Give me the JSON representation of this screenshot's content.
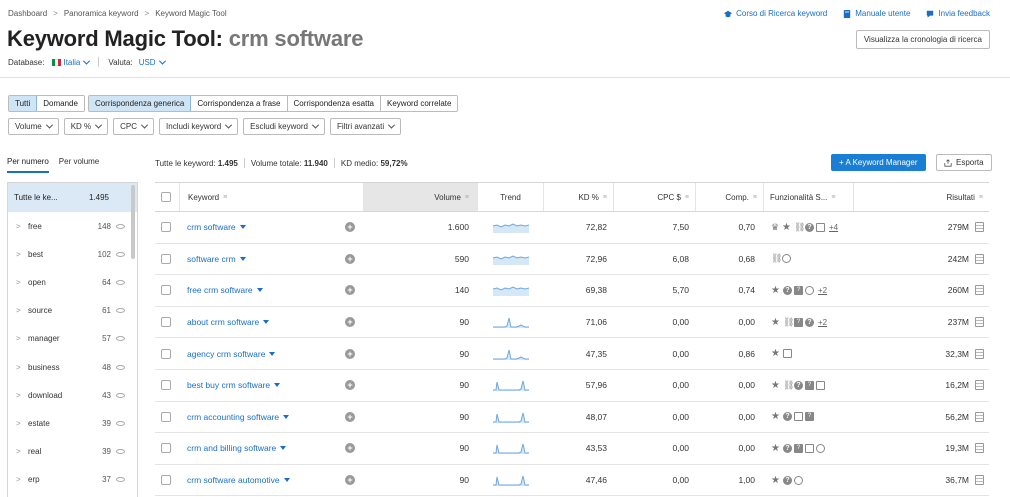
{
  "breadcrumb": [
    "Dashboard",
    "Panoramica keyword",
    "Keyword Magic Tool"
  ],
  "toplinks": {
    "course": "Corso di Ricerca keyword",
    "manual": "Manuale utente",
    "feedback": "Invia feedback"
  },
  "title": {
    "tool": "Keyword Magic Tool:",
    "keyword": "crm software"
  },
  "history_button": "Visualizza la cronologia di ricerca",
  "database": {
    "label": "Database:",
    "value": "Italia"
  },
  "currency": {
    "label": "Valuta:",
    "value": "USD"
  },
  "match_tabs_a": [
    "Tutti",
    "Domande"
  ],
  "match_tabs_b": [
    "Corrispondenza generica",
    "Corrispondenza a frase",
    "Corrispondenza esatta",
    "Keyword correlate"
  ],
  "filters": [
    "Volume",
    "KD %",
    "CPC",
    "Includi keyword",
    "Escludi keyword",
    "Filtri avanzati"
  ],
  "sort_tabs": [
    "Per numero",
    "Per volume"
  ],
  "summary": {
    "kw_label": "Tutte le keyword:",
    "kw_value": "1.495",
    "vol_label": "Volume totale:",
    "vol_value": "11.940",
    "kd_label": "KD medio:",
    "kd_value": "59,72%"
  },
  "buttons": {
    "manager": "+ A Keyword Manager",
    "export": "Esporta"
  },
  "sidebar": {
    "head_label": "Tutte le ke...",
    "head_count": "1.495",
    "items": [
      {
        "label": "free",
        "count": "148"
      },
      {
        "label": "best",
        "count": "102"
      },
      {
        "label": "open",
        "count": "64"
      },
      {
        "label": "source",
        "count": "61"
      },
      {
        "label": "manager",
        "count": "57"
      },
      {
        "label": "business",
        "count": "48"
      },
      {
        "label": "download",
        "count": "43"
      },
      {
        "label": "estate",
        "count": "39"
      },
      {
        "label": "real",
        "count": "39"
      },
      {
        "label": "erp",
        "count": "37"
      }
    ]
  },
  "table": {
    "headers": [
      "Keyword",
      "Volume",
      "Trend",
      "KD %",
      "CPC $",
      "Comp.",
      "Funzionalità S...",
      "Risultati"
    ],
    "rows": [
      {
        "keyword": "crm software",
        "volume": "1.600",
        "kd": "72,82",
        "cpc": "7,50",
        "comp": "0,70",
        "more": "+4",
        "results": "279M",
        "features": [
          "crown",
          "star",
          "link",
          "q",
          "box"
        ],
        "trend": "flat"
      },
      {
        "keyword": "software crm",
        "volume": "590",
        "kd": "72,96",
        "cpc": "6,08",
        "comp": "0,68",
        "more": "",
        "results": "242M",
        "features": [
          "link",
          "circle"
        ],
        "trend": "flat"
      },
      {
        "keyword": "free crm software",
        "volume": "140",
        "kd": "69,38",
        "cpc": "5,70",
        "comp": "0,74",
        "more": "+2",
        "results": "260M",
        "features": [
          "star",
          "q",
          "sq",
          "circle"
        ],
        "trend": "flat"
      },
      {
        "keyword": "about crm software",
        "volume": "90",
        "kd": "71,06",
        "cpc": "0,00",
        "comp": "0,00",
        "more": "+2",
        "results": "237M",
        "features": [
          "star",
          "link",
          "sq",
          "q"
        ],
        "trend": "spike"
      },
      {
        "keyword": "agency crm software",
        "volume": "90",
        "kd": "47,35",
        "cpc": "0,00",
        "comp": "0,86",
        "more": "",
        "results": "32,3M",
        "features": [
          "star",
          "box"
        ],
        "trend": "spike"
      },
      {
        "keyword": "best buy crm software",
        "volume": "90",
        "kd": "57,96",
        "cpc": "0,00",
        "comp": "0,00",
        "more": "",
        "results": "16,2M",
        "features": [
          "star",
          "link",
          "q",
          "sq",
          "box"
        ],
        "trend": "step"
      },
      {
        "keyword": "crm accounting software",
        "volume": "90",
        "kd": "48,07",
        "cpc": "0,00",
        "comp": "0,00",
        "more": "",
        "results": "56,2M",
        "features": [
          "star",
          "q",
          "box",
          "sq"
        ],
        "trend": "step"
      },
      {
        "keyword": "crm and billing software",
        "volume": "90",
        "kd": "43,53",
        "cpc": "0,00",
        "comp": "0,00",
        "more": "",
        "results": "19,3M",
        "features": [
          "star",
          "q",
          "sq",
          "box",
          "circle"
        ],
        "trend": "step"
      },
      {
        "keyword": "crm software automotive",
        "volume": "90",
        "kd": "47,46",
        "cpc": "0,00",
        "comp": "1,00",
        "more": "",
        "results": "36,7M",
        "features": [
          "star",
          "q",
          "circle"
        ],
        "trend": "step"
      }
    ]
  },
  "colors": {
    "accent": "#1a6fc4",
    "button": "#1a7fd4",
    "active_tab": "#cfe4f4",
    "sidebar_active": "#dbe9f6"
  }
}
